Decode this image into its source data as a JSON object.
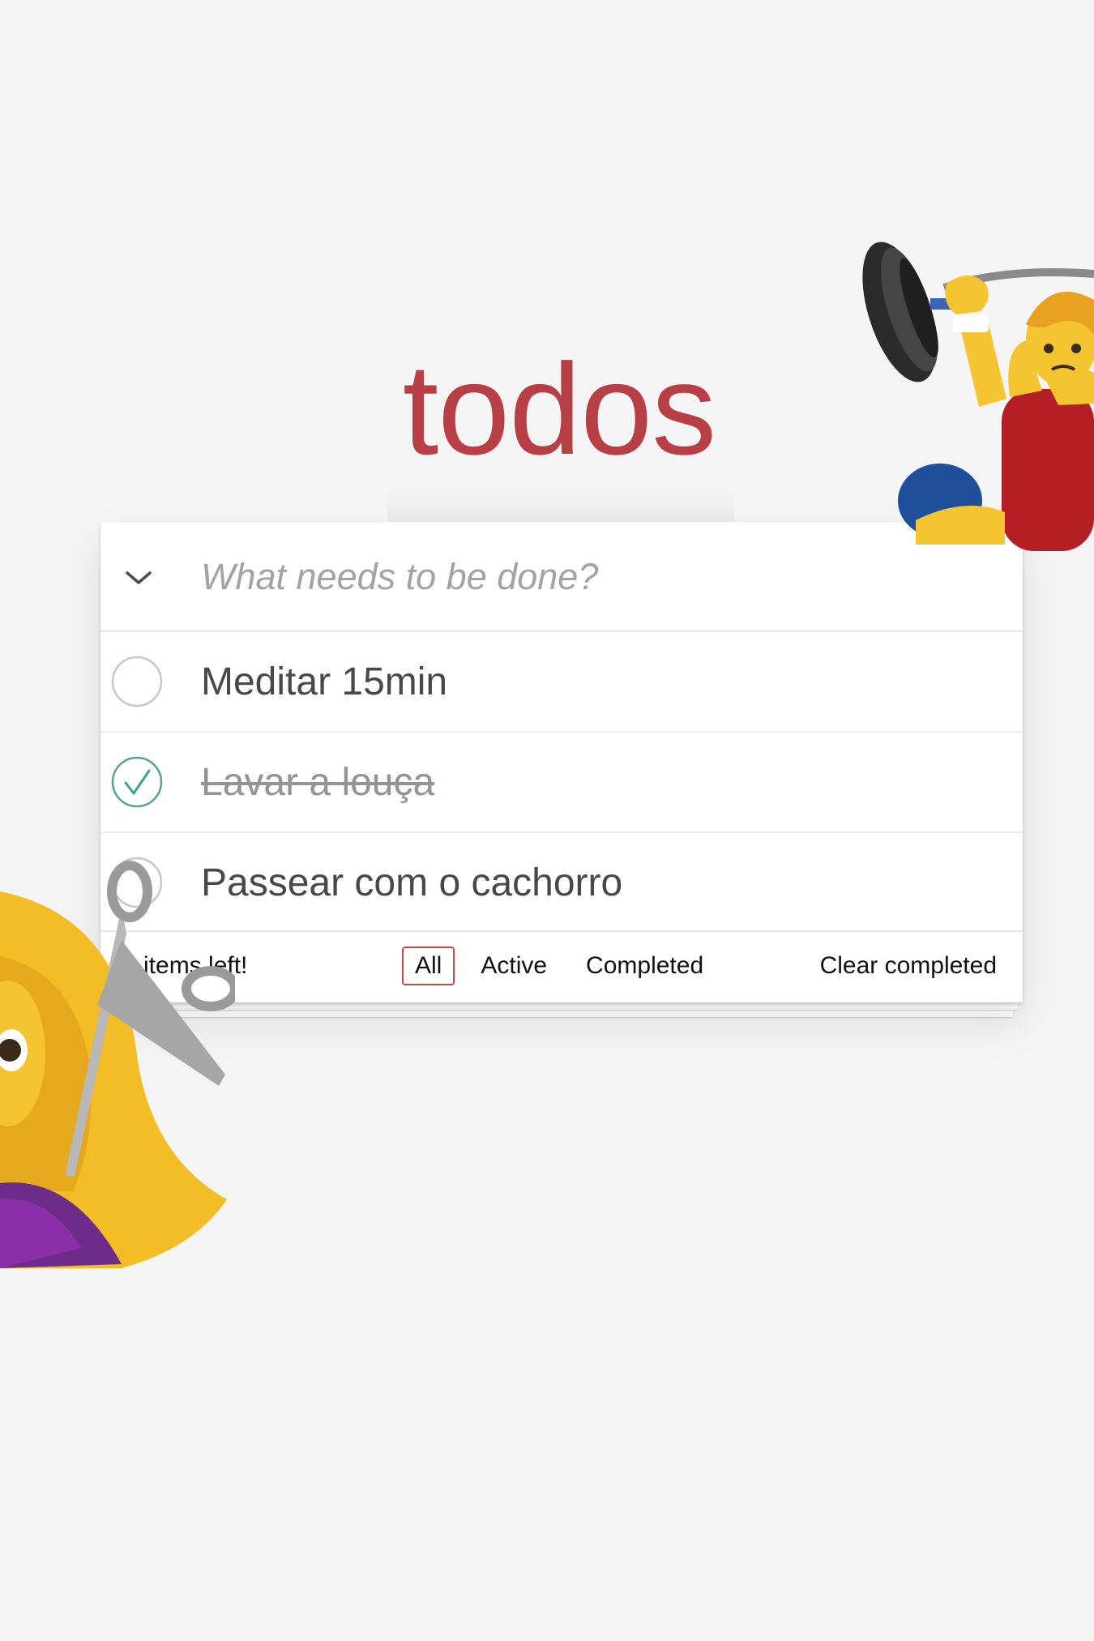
{
  "app": {
    "title": "todos"
  },
  "new_todo": {
    "placeholder": "What needs to be done?",
    "value": ""
  },
  "toggle_all_icon": "chevron-down-icon",
  "todos": [
    {
      "label": "Meditar 15min",
      "completed": false
    },
    {
      "label": "Lavar a louça",
      "completed": true
    },
    {
      "label": "Passear com o cachorro",
      "completed": false
    }
  ],
  "footer": {
    "count": "2 items left!",
    "filters": [
      {
        "label": "All",
        "selected": true
      },
      {
        "label": "Active",
        "selected": false
      },
      {
        "label": "Completed",
        "selected": false
      }
    ],
    "clear_completed": "Clear completed"
  },
  "decorations": {
    "top_right": "man-weightlifter-emoji",
    "bottom_left": "woman-with-scissors-emoji"
  },
  "colors": {
    "title": "#b83f45",
    "checked": "#5dc2af",
    "selected_filter_border": "#ce4646",
    "background": "#f5f5f5"
  }
}
